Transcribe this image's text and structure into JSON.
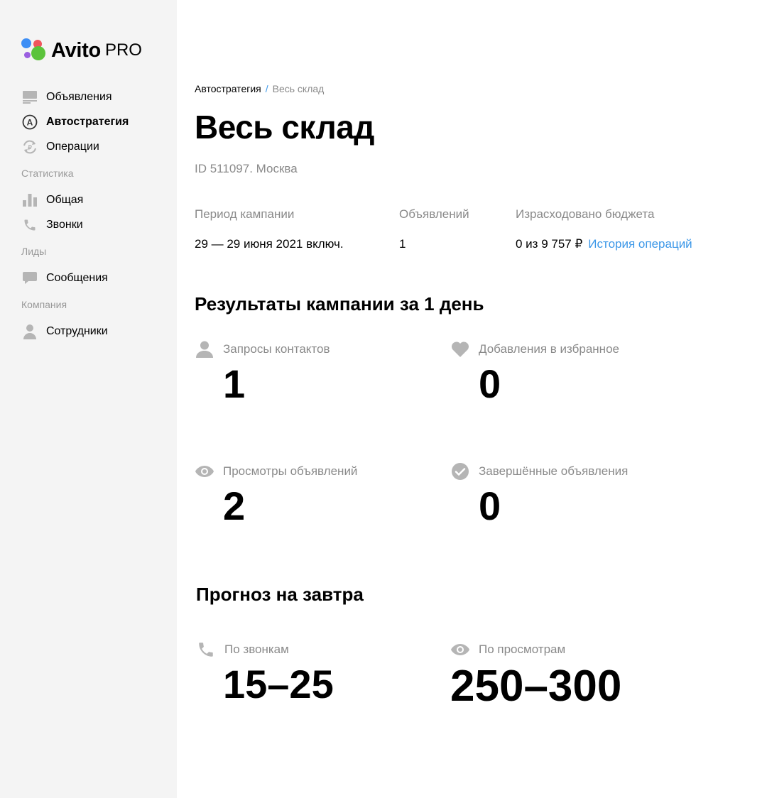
{
  "brand": {
    "name": "Avito",
    "suffix": "PRO"
  },
  "sidebar": {
    "items": [
      {
        "label": "Объявления",
        "icon": "ads-icon"
      },
      {
        "label": "Автостратегия",
        "icon": "autostrategy-icon",
        "active": true
      },
      {
        "label": "Операции",
        "icon": "operations-icon"
      }
    ],
    "sections": [
      {
        "title": "Статистика",
        "items": [
          {
            "label": "Общая",
            "icon": "bar-chart-icon"
          },
          {
            "label": "Звонки",
            "icon": "phone-icon"
          }
        ]
      },
      {
        "title": "Лиды",
        "items": [
          {
            "label": "Сообщения",
            "icon": "message-icon"
          }
        ]
      },
      {
        "title": "Компания",
        "items": [
          {
            "label": "Сотрудники",
            "icon": "user-icon"
          }
        ]
      }
    ]
  },
  "breadcrumb": {
    "root": "Автостратегия",
    "separator": "/",
    "current": "Весь склад"
  },
  "page": {
    "title": "Весь склад",
    "subtitle": "ID 511097. Москва"
  },
  "campaign": {
    "period_label": "Период кампании",
    "period_value": "29 — 29 июня 2021 включ.",
    "ads_label": "Объявлений",
    "ads_value": "1",
    "budget_label": "Израсходовано бюджета",
    "budget_value": "0 из 9 757 ₽",
    "history_link": "История операций"
  },
  "results": {
    "title": "Результаты кампании за 1 день",
    "stats": [
      {
        "label": "Запросы контактов",
        "value": "1",
        "icon": "user-icon"
      },
      {
        "label": "Добавления в избранное",
        "value": "0",
        "icon": "heart-icon"
      },
      {
        "label": "Просмотры объявлений",
        "value": "2",
        "icon": "eye-icon"
      },
      {
        "label": "Завершённые объявления",
        "value": "0",
        "icon": "check-circle-icon"
      }
    ]
  },
  "forecast": {
    "title": "Прогноз на завтра",
    "stats": [
      {
        "label": "По звонкам",
        "value": "15–25",
        "icon": "phone-icon"
      },
      {
        "label": "По просмотрам",
        "value": "250–300",
        "icon": "eye-icon"
      }
    ]
  },
  "colors": {
    "sidebar_bg": "#f4f4f4",
    "link": "#3b97e8",
    "muted": "#8a8a8a",
    "icon": "#b5b5b5"
  }
}
